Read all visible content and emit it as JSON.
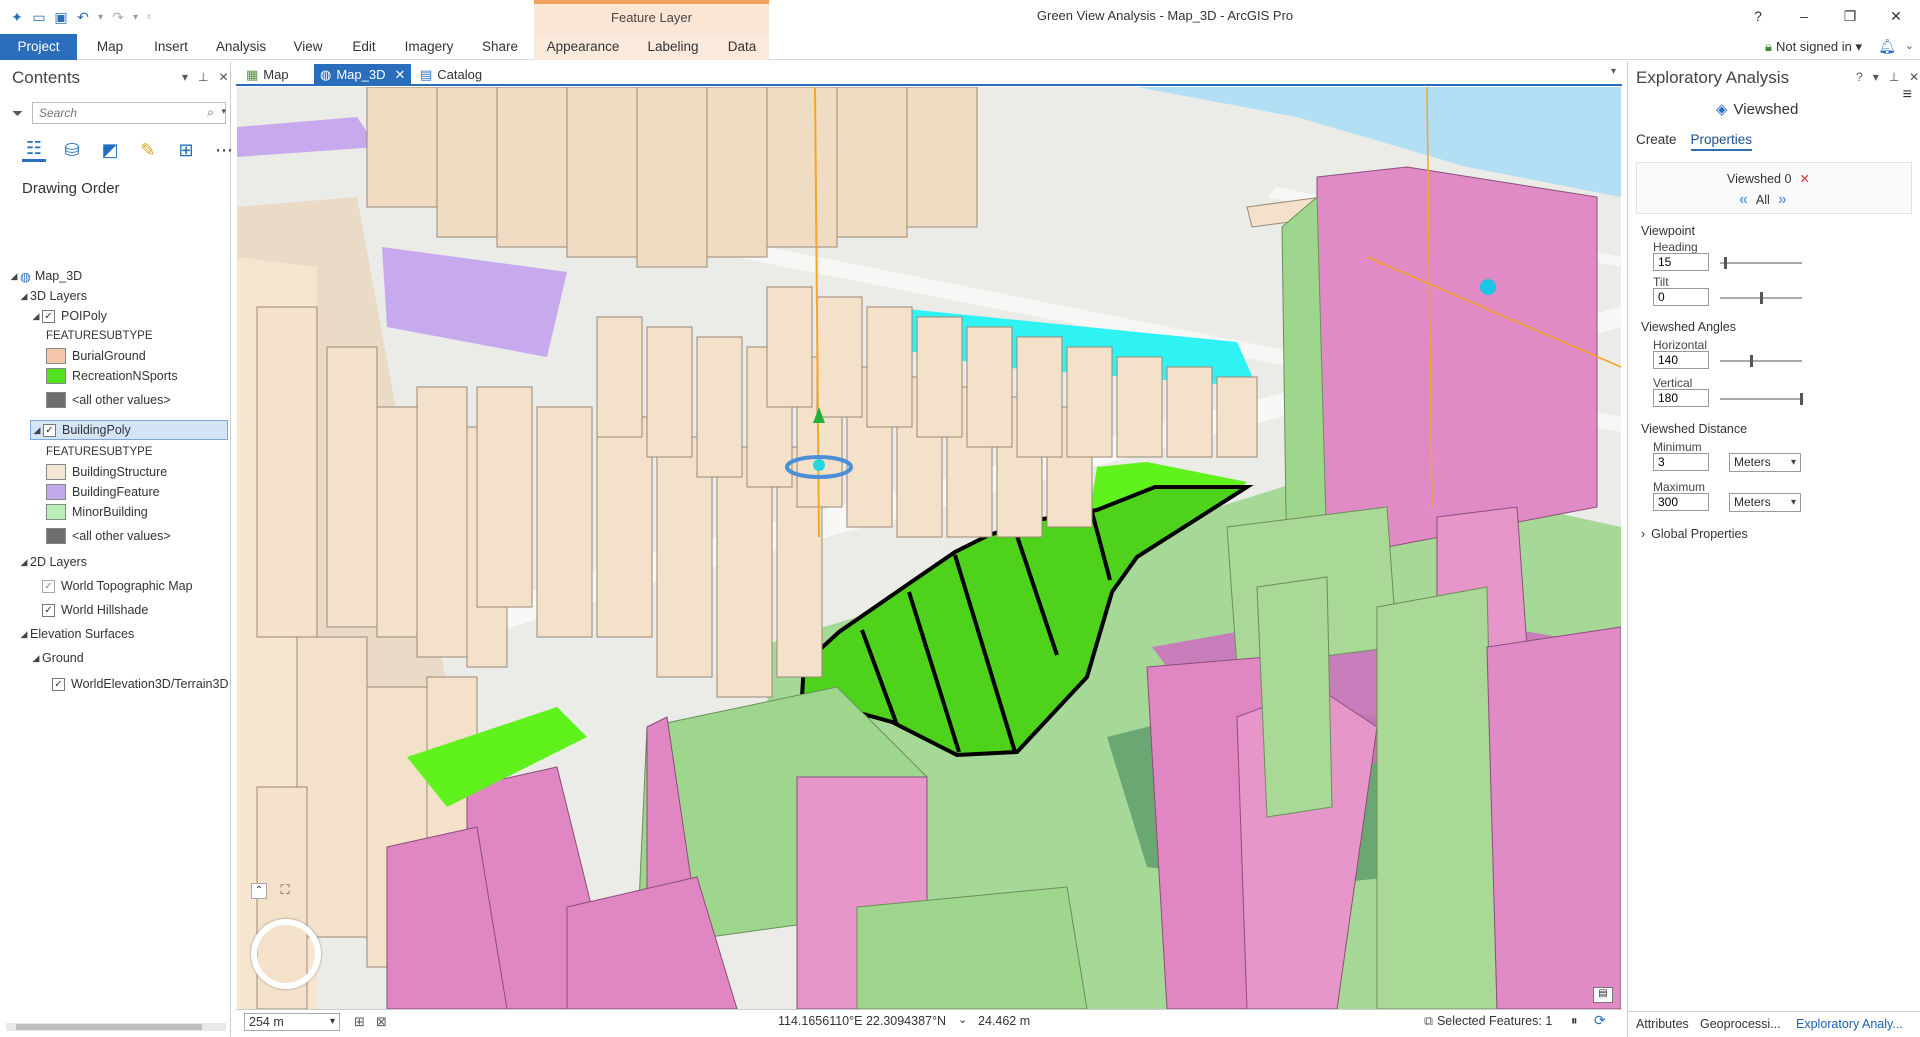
{
  "window": {
    "title": "Green View Analysis - Map_3D - ArcGIS Pro",
    "context_tab_group": "Feature Layer",
    "help": "?",
    "minimize": "–",
    "restore": "❐",
    "close": "✕"
  },
  "ribbon": {
    "tabs": [
      "Project",
      "Map",
      "Insert",
      "Analysis",
      "View",
      "Edit",
      "Imagery",
      "Share",
      "Appearance",
      "Labeling",
      "Data"
    ],
    "account": "Not signed in ▾"
  },
  "contents": {
    "title": "Contents",
    "search_placeholder": "Search",
    "drawing_order": "Drawing Order",
    "map_name": "Map_3D",
    "group_3d": "3D Layers",
    "poi_layer": "POIPoly",
    "poi_field": "FEATURESUBTYPE",
    "poi_classes": [
      {
        "label": "BurialGround",
        "color": "#f4c5a8"
      },
      {
        "label": "RecreationNSports",
        "color": "#4fe31f"
      },
      {
        "label": "<all other values>",
        "color": "#6e6e6e"
      }
    ],
    "building_layer": "BuildingPoly",
    "building_field": "FEATURESUBTYPE",
    "building_classes": [
      {
        "label": "BuildingStructure",
        "color": "#f5e6d3"
      },
      {
        "label": "BuildingFeature",
        "color": "#c3a8ec"
      },
      {
        "label": "MinorBuilding",
        "color": "#b9eeb4"
      },
      {
        "label": "<all other values>",
        "color": "#6e6e6e"
      }
    ],
    "group_2d": "2D Layers",
    "basemap_1": "World Topographic Map",
    "basemap_2": "World Hillshade",
    "group_elev": "Elevation Surfaces",
    "ground": "Ground",
    "elevation_source": "WorldElevation3D/Terrain3D"
  },
  "view_tabs": [
    "Map",
    "Map_3D",
    "Catalog"
  ],
  "map_status": {
    "scale": "254 m",
    "coordinates": "114.1656110°E 22.3094387°N",
    "elevation": "24.462 m",
    "selected_features": "Selected Features: 1"
  },
  "exploratory": {
    "title": "Exploratory Analysis",
    "tool": "Viewshed",
    "tabs": [
      "Create",
      "Properties"
    ],
    "item": "Viewshed 0",
    "nav_all": "All",
    "viewpoint": "Viewpoint",
    "heading_label": "Heading",
    "heading": "15",
    "tilt_label": "Tilt",
    "tilt": "0",
    "angles": "Viewshed Angles",
    "horizontal_label": "Horizontal",
    "horizontal": "140",
    "vertical_label": "Vertical",
    "vertical": "180",
    "distance": "Viewshed Distance",
    "minimum_label": "Minimum",
    "minimum": "3",
    "min_unit": "Meters",
    "maximum_label": "Maximum",
    "maximum": "300",
    "max_unit": "Meters",
    "global": "Global Properties",
    "bottom_tabs": [
      "Attributes",
      "Geoprocessi...",
      "Exploratory Analy..."
    ]
  }
}
